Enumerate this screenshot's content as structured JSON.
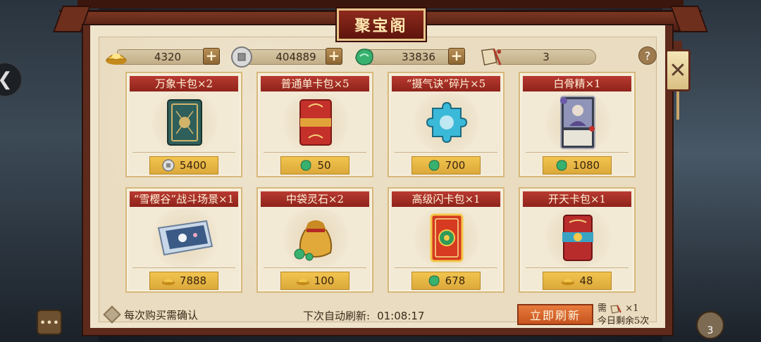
{
  "title": "聚宝阁",
  "currencies": [
    {
      "name": "gold-ingot",
      "value": "4320",
      "color": "#e3b23c"
    },
    {
      "name": "silver-coin",
      "value": "404889",
      "color": "#c8c8c8"
    },
    {
      "name": "jade-stone",
      "value": "33836",
      "color": "#3db37a"
    },
    {
      "name": "refresh-token",
      "value": "3",
      "color": "#d8c8a6"
    }
  ],
  "help_label": "?",
  "close_label": "✕",
  "cards": [
    {
      "name": "万象卡包×2",
      "price": "5400",
      "currency": "silver"
    },
    {
      "name": "普通单卡包×5",
      "price": "50",
      "currency": "jade"
    },
    {
      "name": "“摄气诀”碎片×5",
      "price": "700",
      "currency": "jade"
    },
    {
      "name": "白骨精×1",
      "price": "1080",
      "currency": "jade"
    },
    {
      "name": "“雪樱谷”战斗场景×1",
      "price": "7888",
      "currency": "gold"
    },
    {
      "name": "中袋灵石×2",
      "price": "100",
      "currency": "gold"
    },
    {
      "name": "高级闪卡包×1",
      "price": "678",
      "currency": "jade"
    },
    {
      "name": "开天卡包×1",
      "price": "48",
      "currency": "gold"
    }
  ],
  "bottom": {
    "confirm_label": "每次购买需确认",
    "next_refresh_label": "下次自动刷新:",
    "next_refresh_time": "01:08:17",
    "refresh_button": "立即刷新",
    "cost_prefix": "需",
    "cost_suffix": "×1",
    "remaining": "今日剩余5次"
  },
  "bag_count": "3"
}
